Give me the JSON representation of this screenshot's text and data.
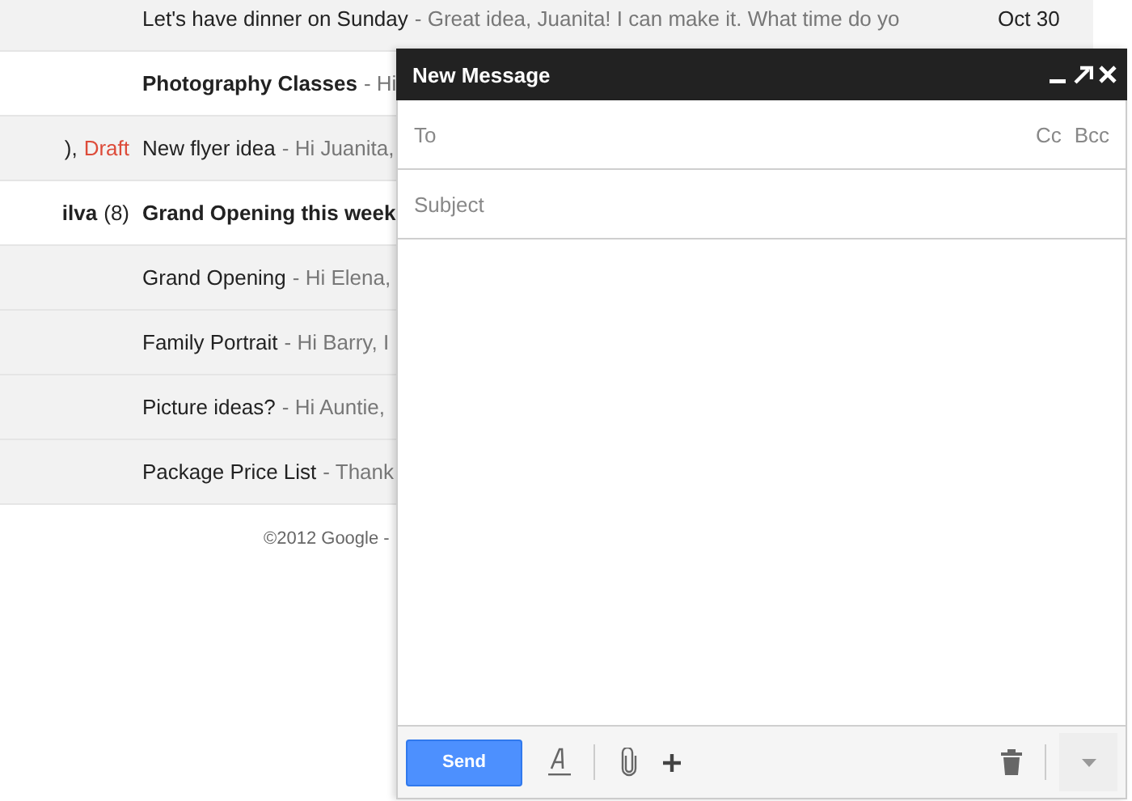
{
  "threads": [
    {
      "subject": "Let's have dinner on Sunday",
      "snippet": "- Great idea, Juanita! I can make it. What time do yo",
      "date": "Oct 30",
      "unread": false
    },
    {
      "subject": "Photography Classes",
      "snippet": "- Hi",
      "unread": true
    },
    {
      "sender": [
        {
          "text": "),",
          "kind": "plain"
        },
        {
          "text": "Draft",
          "kind": "draft"
        }
      ],
      "subject": "New flyer idea",
      "snippet": "- Hi Juanita,",
      "unread": false
    },
    {
      "sender": [
        {
          "text": "ilva",
          "kind": "name"
        },
        {
          "text": "(8)",
          "kind": "count"
        }
      ],
      "subject": "Grand Opening this week",
      "unread": true
    },
    {
      "subject": "Grand Opening",
      "snippet": "- Hi Elena,",
      "unread": false
    },
    {
      "subject": "Family Portrait",
      "snippet": "- Hi Barry, I",
      "unread": false
    },
    {
      "subject": "Picture ideas?",
      "snippet": "- Hi Auntie,",
      "unread": false
    },
    {
      "subject": "Package Price List",
      "snippet": "- Thank",
      "unread": false
    }
  ],
  "footer": "©2012 Google -",
  "compose": {
    "title": "New Message",
    "to_placeholder": "To",
    "cc": "Cc",
    "bcc": "Bcc",
    "subject_placeholder": "Subject",
    "send": "Send"
  }
}
